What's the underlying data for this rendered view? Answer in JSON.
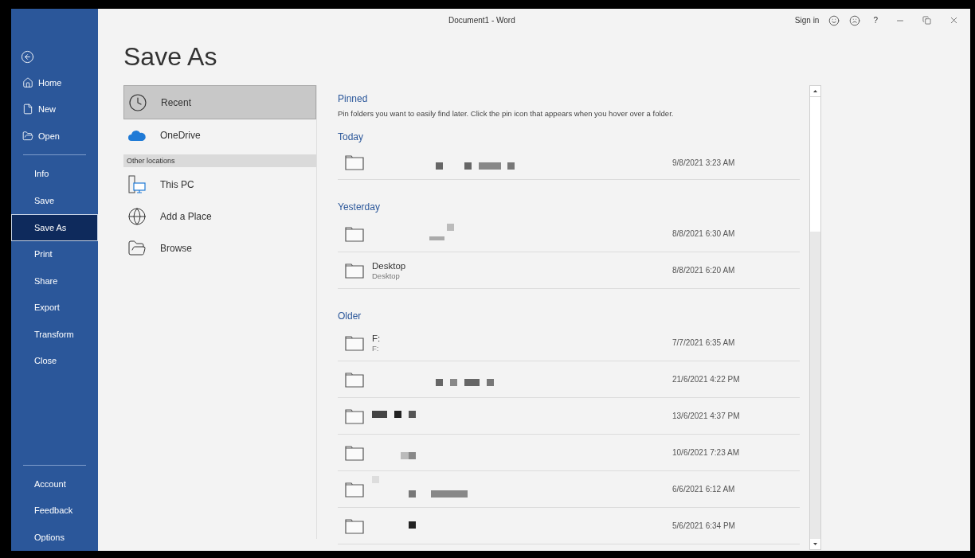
{
  "window": {
    "title": "Document1 - Word",
    "sign_in": "Sign in",
    "help": "?"
  },
  "sidebar": {
    "primary": [
      {
        "label": "Home",
        "selected": false
      },
      {
        "label": "New",
        "selected": false
      },
      {
        "label": "Open",
        "selected": false
      }
    ],
    "secondary": [
      {
        "label": "Info",
        "selected": false
      },
      {
        "label": "Save",
        "selected": false
      },
      {
        "label": "Save As",
        "selected": true
      },
      {
        "label": "Print",
        "selected": false
      },
      {
        "label": "Share",
        "selected": false
      },
      {
        "label": "Export",
        "selected": false
      },
      {
        "label": "Transform",
        "selected": false
      },
      {
        "label": "Close",
        "selected": false
      }
    ],
    "footer": [
      {
        "label": "Account",
        "selected": false
      },
      {
        "label": "Feedback",
        "selected": false
      },
      {
        "label": "Options",
        "selected": false
      }
    ]
  },
  "heading": "Save As",
  "locations": {
    "top": [
      {
        "label": "Recent",
        "selected": true
      },
      {
        "label": "OneDrive",
        "selected": false
      }
    ],
    "other_header": "Other locations",
    "other": [
      {
        "label": "This PC",
        "selected": false
      },
      {
        "label": "Add a Place",
        "selected": false
      },
      {
        "label": "Browse",
        "selected": false
      }
    ]
  },
  "pinned": {
    "title": "Pinned",
    "description": "Pin folders you want to easily find later. Click the pin icon that appears when you hover over a folder."
  },
  "groups": [
    {
      "title": "Today",
      "rows": [
        {
          "kind": "redacted",
          "date": "9/8/2021 3:23 AM"
        }
      ]
    },
    {
      "title": "Yesterday",
      "rows": [
        {
          "kind": "redacted",
          "date": "8/8/2021 6:30 AM"
        },
        {
          "kind": "named",
          "name": "Desktop",
          "path": "Desktop",
          "date": "8/8/2021 6:20 AM"
        }
      ]
    },
    {
      "title": "Older",
      "rows": [
        {
          "kind": "named",
          "name": "F:",
          "path": "F:",
          "date": "7/7/2021 6:35 AM"
        },
        {
          "kind": "redacted",
          "date": "21/6/2021 4:22 PM"
        },
        {
          "kind": "redacted",
          "date": "13/6/2021 4:37 PM"
        },
        {
          "kind": "redacted",
          "date": "10/6/2021 7:23 AM"
        },
        {
          "kind": "redacted",
          "date": "6/6/2021 6:12 AM"
        },
        {
          "kind": "redacted",
          "date": "5/6/2021 6:34 PM"
        }
      ]
    }
  ]
}
